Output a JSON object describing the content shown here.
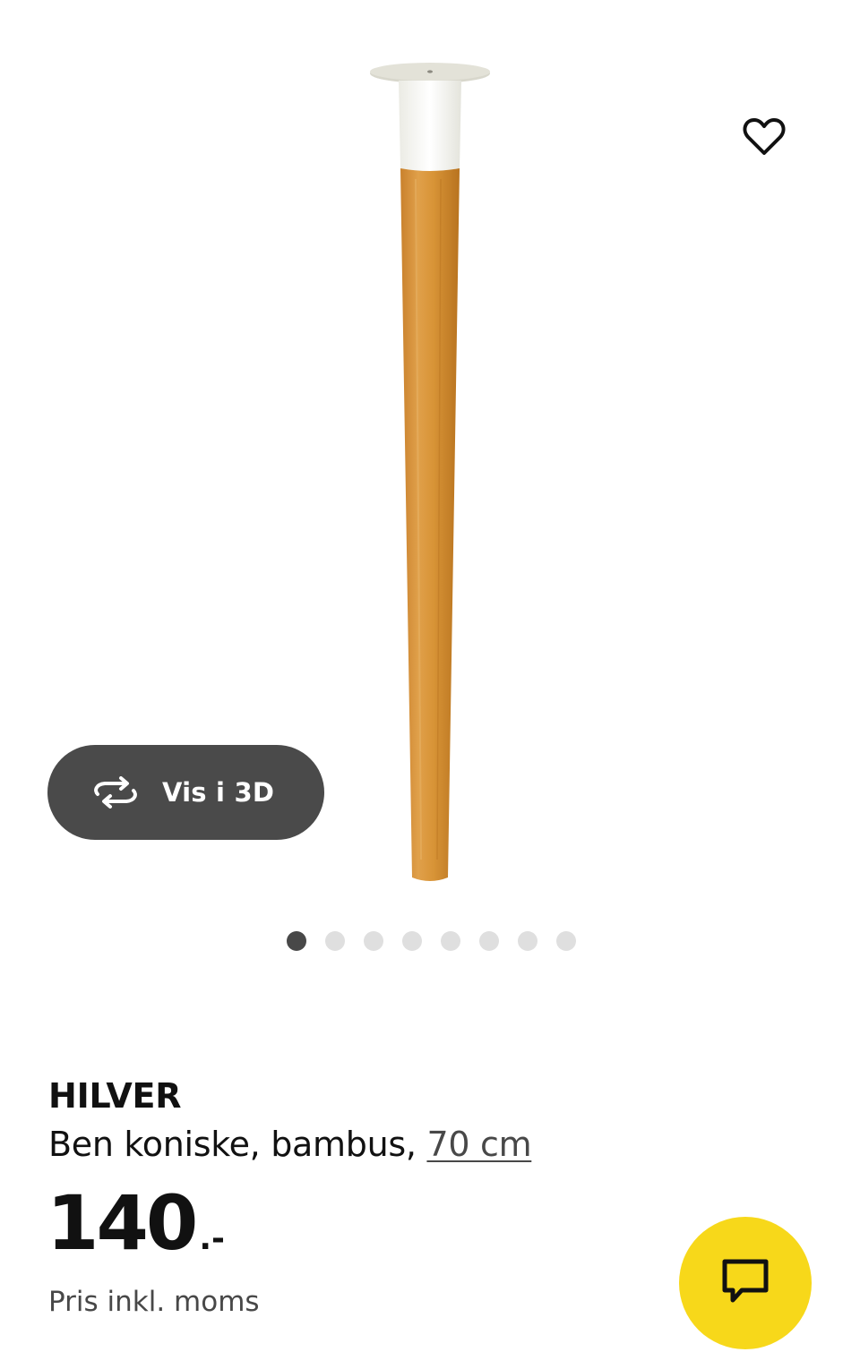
{
  "view_3d": {
    "label": "Vis i 3D",
    "icon": "rotate-3d-icon"
  },
  "favorite": {
    "icon": "heart-outline-icon"
  },
  "gallery": {
    "image_count": 8,
    "active_index": 0
  },
  "product": {
    "name": "HILVER",
    "description_prefix": "Ben koniske, bambus, ",
    "size_option": "70 cm",
    "price_integer": "140",
    "price_suffix": ".-",
    "price_note": "Pris inkl. moms"
  },
  "chat": {
    "icon": "chat-bubble-icon"
  },
  "colors": {
    "chat_button_bg": "#f7d81a",
    "view_3d_bg": "#4a4a4a",
    "dot_active": "#484848",
    "dot_inactive": "#dfdfdf"
  }
}
